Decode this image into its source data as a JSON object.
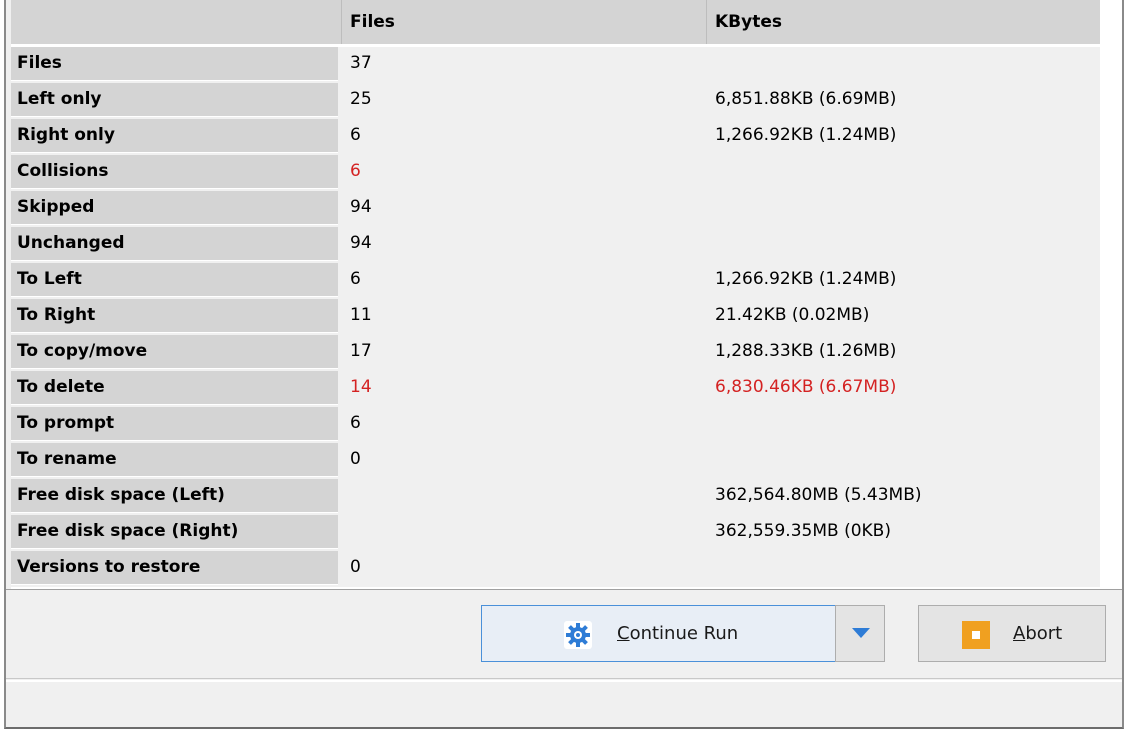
{
  "table": {
    "headers": {
      "label": "",
      "files": "Files",
      "kbytes": "KBytes"
    },
    "rows": [
      {
        "label": "Files",
        "files": "37",
        "kbytes": ""
      },
      {
        "label": "Left only",
        "files": "25",
        "kbytes": "6,851.88KB (6.69MB)"
      },
      {
        "label": "Right only",
        "files": "6",
        "kbytes": "1,266.92KB (1.24MB)"
      },
      {
        "label": "Collisions",
        "files": "6",
        "kbytes": ""
      },
      {
        "label": "Skipped",
        "files": "94",
        "kbytes": ""
      },
      {
        "label": "Unchanged",
        "files": "94",
        "kbytes": ""
      },
      {
        "label": "To Left",
        "files": "6",
        "kbytes": "1,266.92KB (1.24MB)"
      },
      {
        "label": "To Right",
        "files": "11",
        "kbytes": "21.42KB (0.02MB)"
      },
      {
        "label": "To copy/move",
        "files": "17",
        "kbytes": "1,288.33KB (1.26MB)"
      },
      {
        "label": "To delete",
        "files": "14",
        "kbytes": "6,830.46KB (6.67MB)"
      },
      {
        "label": "To prompt",
        "files": "6",
        "kbytes": ""
      },
      {
        "label": "To rename",
        "files": "0",
        "kbytes": ""
      },
      {
        "label": "Free disk space (Left)",
        "files": "",
        "kbytes": "362,564.80MB (5.43MB)"
      },
      {
        "label": "Free disk space (Right)",
        "files": "",
        "kbytes": "362,559.35MB (0KB)"
      },
      {
        "label": "Versions to restore",
        "files": "0",
        "kbytes": ""
      }
    ]
  },
  "buttons": {
    "continue_first": "C",
    "continue_rest": "ontinue Run",
    "abort_first": "A",
    "abort_rest": "bort"
  },
  "colors": {
    "warning_text": "#d42222",
    "accent_blue": "#2e7cd6",
    "abort_orange": "#f0a020"
  },
  "icons": {
    "continue": "gear-icon",
    "dropdown": "chevron-down-icon",
    "abort": "stop-icon"
  }
}
